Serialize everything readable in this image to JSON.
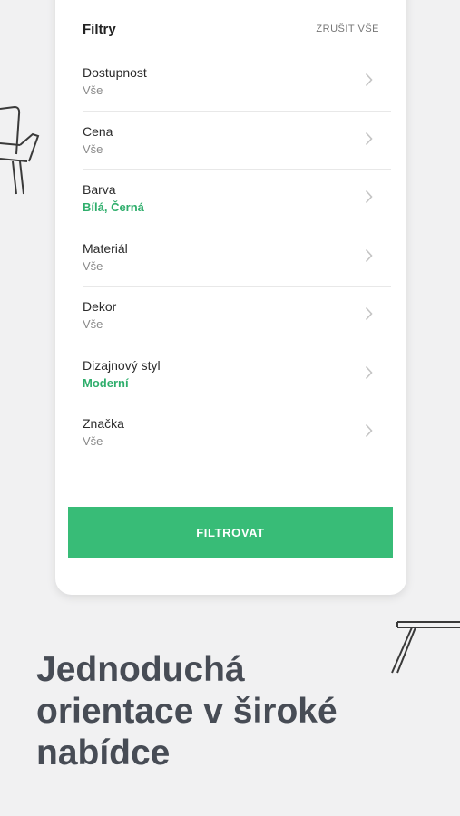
{
  "filters": {
    "title": "Filtry",
    "clear_all": "ZRUŠIT VŠE",
    "items": [
      {
        "label": "Dostupnost",
        "value": "Vše",
        "active": false
      },
      {
        "label": "Cena",
        "value": "Vše",
        "active": false
      },
      {
        "label": "Barva",
        "value": "Bílá, Černá",
        "active": true
      },
      {
        "label": "Materiál",
        "value": "Vše",
        "active": false
      },
      {
        "label": "Dekor",
        "value": "Vše",
        "active": false
      },
      {
        "label": "Dizajnový styl",
        "value": "Moderní",
        "active": true
      },
      {
        "label": "Značka",
        "value": "Vše",
        "active": false
      }
    ],
    "submit_label": "FILTROVAT"
  },
  "tagline": {
    "line1": "Jednoduchá",
    "line2": "orientace v široké",
    "line3": "nabídce"
  },
  "colors": {
    "accent": "#38bc77",
    "active_value": "#2fae6c",
    "background": "#f1f1f2",
    "headline": "#474c55"
  }
}
